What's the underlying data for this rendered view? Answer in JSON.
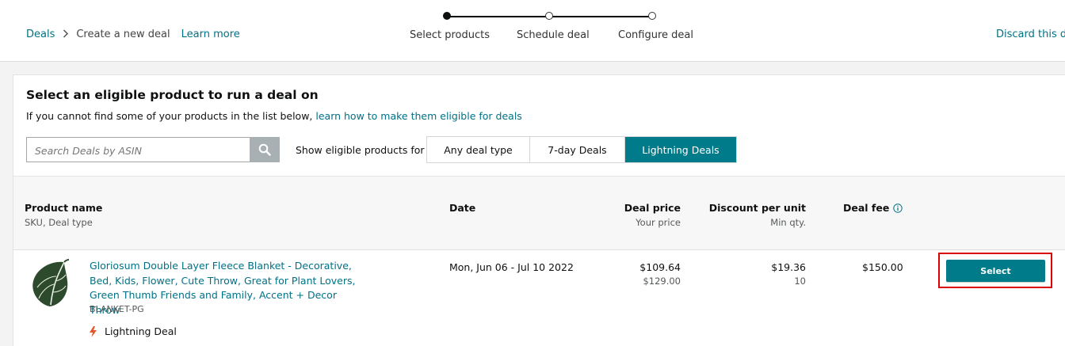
{
  "breadcrumb": {
    "root": "Deals",
    "current": "Create a new deal",
    "learn_more": "Learn more"
  },
  "stepper": {
    "steps": [
      {
        "label": "Select products",
        "state": "current"
      },
      {
        "label": "Schedule deal",
        "state": "upcoming"
      },
      {
        "label": "Configure deal",
        "state": "upcoming"
      }
    ]
  },
  "header": {
    "discard": "Discard this de"
  },
  "panel": {
    "title": "Select an eligible product to run a deal on",
    "subtitle_prefix": "If you cannot find some of your products in the list below, ",
    "subtitle_link": "learn how to make them eligible for deals"
  },
  "search": {
    "placeholder": "Search Deals by ASIN",
    "icon": "search-icon"
  },
  "filter": {
    "label": "Show eligible products for",
    "options": [
      "Any deal type",
      "7-day Deals",
      "Lightning Deals"
    ],
    "selected": "Lightning Deals"
  },
  "table": {
    "columns": {
      "product": {
        "title": "Product name",
        "sub": "SKU, Deal type"
      },
      "date": {
        "title": "Date"
      },
      "deal_price": {
        "title": "Deal price",
        "sub": "Your price"
      },
      "discount": {
        "title": "Discount per unit",
        "sub": "Min qty."
      },
      "deal_fee": {
        "title": "Deal fee",
        "icon": "info-icon"
      }
    },
    "rows": [
      {
        "name": "Gloriosum Double Layer Fleece Blanket - Decorative, Bed, Kids, Flower, Cute Throw, Great for Plant Lovers, Green Thumb Friends and Family, Accent + Decor Throw",
        "sku": "BLANKET-PG",
        "deal_type": "Lightning Deal",
        "date": "Mon, Jun 06 - Jul 10 2022",
        "deal_price": "$109.64",
        "your_price": "$129.00",
        "discount": "$19.36",
        "min_qty": "10",
        "deal_fee": "$150.00",
        "action": "Select"
      }
    ]
  },
  "colors": {
    "accent": "#007b8a",
    "link": "#007185",
    "highlight": "#dd0000"
  }
}
